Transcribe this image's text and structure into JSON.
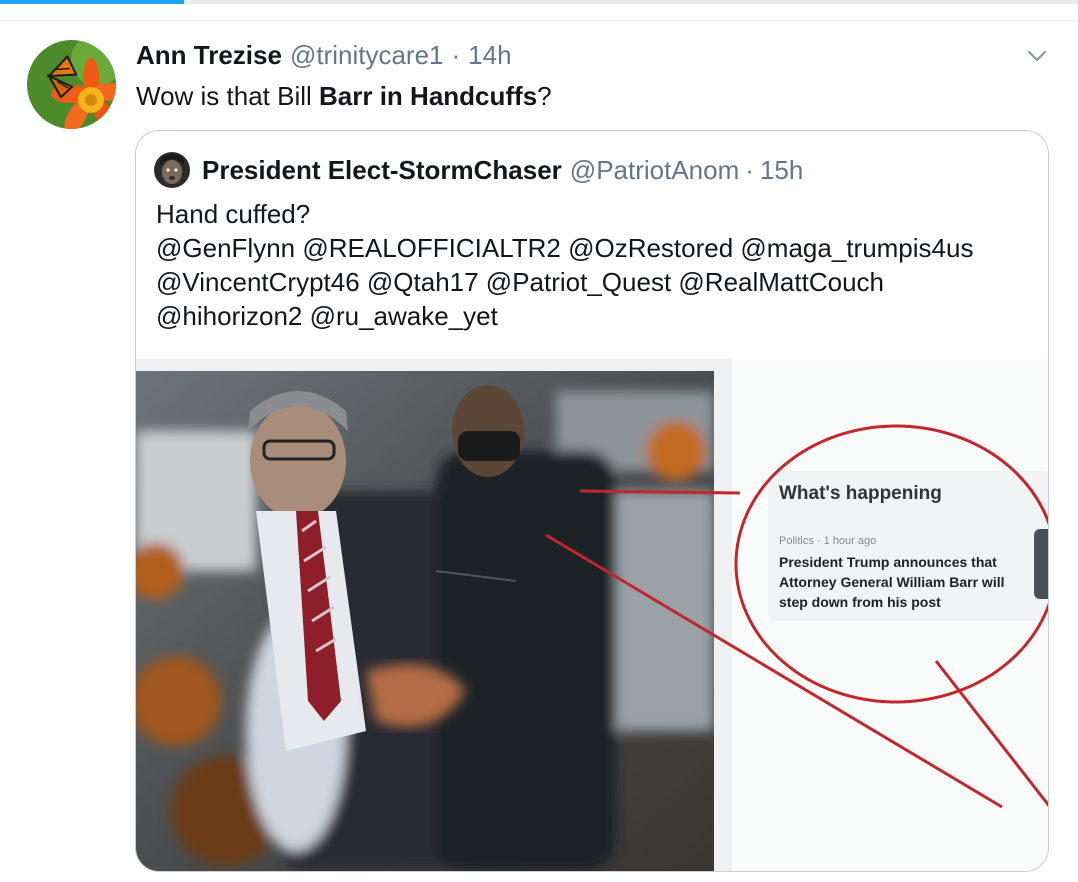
{
  "tweet": {
    "author_name": "Ann Trezise",
    "handle": "@trinitycare1",
    "separator": "·",
    "time": "14h",
    "text_plain_1": "Wow is that Bill ",
    "text_bold": "Barr in Handcuffs",
    "text_plain_2": "?",
    "menu_icon": "chevron-down-icon"
  },
  "quoted_tweet": {
    "author_name": "President Elect-StormChaser",
    "handle": "@PatriotAnom",
    "separator": "·",
    "time": "15h",
    "text_line_1": "Hand cuffed?",
    "mentions_line_1": "@GenFlynn @REALOFFICIALTR2 @OzRestored @maga_trumpis4us",
    "mentions_line_2": "@VincentCrypt46 @Qtah17 @Patriot_Quest @RealMattCouch",
    "mentions_line_3": "@hihorizon2 @ru_awake_yet",
    "media": {
      "panel_title": "What's happening",
      "panel_meta": "Politics · 1 hour ago",
      "panel_headline": "President Trump announces that Attorney General William Barr will step down from his post",
      "annotation_color": "#c0282d"
    }
  },
  "colors": {
    "accent": "#1da1f2",
    "secondary_text": "#657786",
    "border": "#c4cfd6"
  }
}
